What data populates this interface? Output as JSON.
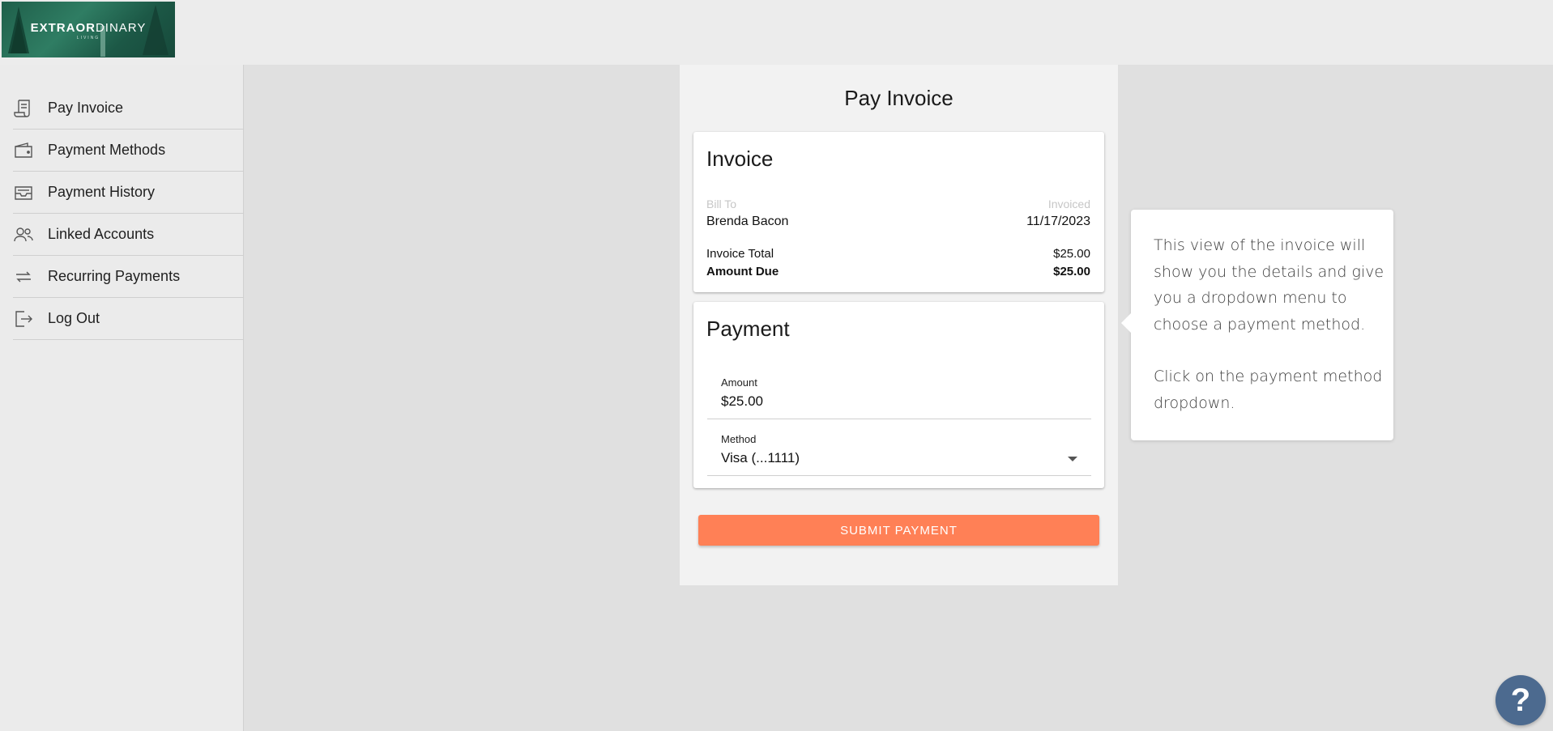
{
  "brand": {
    "logo_main": "EXTRAOR",
    "logo_thin": "DINARY",
    "logo_sub": "LIVING"
  },
  "sidebar": {
    "items": [
      {
        "label": "Pay Invoice",
        "icon": "receipt-icon"
      },
      {
        "label": "Payment Methods",
        "icon": "wallet-icon"
      },
      {
        "label": "Payment History",
        "icon": "inbox-icon"
      },
      {
        "label": "Linked Accounts",
        "icon": "users-icon"
      },
      {
        "label": "Recurring Payments",
        "icon": "repeat-icon"
      },
      {
        "label": "Log Out",
        "icon": "logout-icon"
      }
    ]
  },
  "page": {
    "title": "Pay Invoice"
  },
  "invoice": {
    "title": "Invoice",
    "bill_to_label": "Bill To",
    "invoiced_label": "Invoiced",
    "customer_name": "Brenda Bacon",
    "invoiced_date": "11/17/2023",
    "total_label": "Invoice Total",
    "total_value": "$25.00",
    "due_label": "Amount Due",
    "due_value": "$25.00"
  },
  "payment": {
    "title": "Payment",
    "amount_label": "Amount",
    "amount_value": "$25.00",
    "method_label": "Method",
    "method_value": "Visa (...1111)",
    "submit_label": "SUBMIT PAYMENT"
  },
  "tooltip": {
    "text1": "This view of the invoice will show you the details and give you a dropdown menu to choose a payment method.",
    "text2": "Click on the payment method dropdown."
  },
  "help": {
    "label": "?"
  },
  "colors": {
    "accent": "#ff8056",
    "help": "#4c6a8f",
    "logo_bg": "#1f5f4a"
  }
}
